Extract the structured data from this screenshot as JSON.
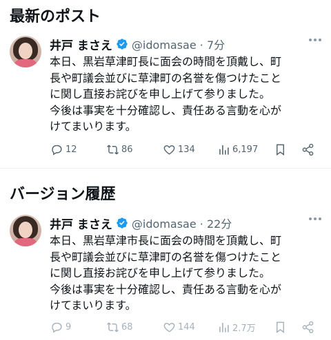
{
  "sections": {
    "latest_title": "最新のポスト",
    "history_title": "バージョン履歴"
  },
  "latest": {
    "name": "井戸 まさえ",
    "handle": "@idomasae · 7分",
    "lines": [
      "本日、黒岩草津町長に面会の時間を頂戴し、町",
      "長や町議会並びに草津町の名誉を傷つけたこと",
      "に関し直接お詫びを申し上げて参りました。",
      "今後は事実を十分確認し、責任ある言動を心が",
      "けてまいります。"
    ],
    "replies": "12",
    "reposts": "86",
    "likes": "134",
    "views": "6,197"
  },
  "history": {
    "name": "井戸 まさえ",
    "handle": "@idomasae · 22分",
    "lines": [
      "本日、黒岩草津市長に面会の時間を頂戴し、町",
      "長や町議会並びに草津町の名誉を傷つけたこと",
      "に関し直接お詫びを申し上げて参りました。",
      "今後は事実を十分確認し、責任ある言動を心が",
      "けてまいります。"
    ],
    "replies": "9",
    "reposts": "68",
    "likes": "144",
    "views": "2.7万"
  },
  "colors": {
    "text": "#0f1419",
    "secondary": "#536471",
    "verified": "#1d9bf0"
  },
  "icons": [
    "verified-badge-icon",
    "more-icon",
    "reply-icon",
    "repost-icon",
    "like-icon",
    "views-icon",
    "bookmark-icon",
    "share-icon"
  ]
}
